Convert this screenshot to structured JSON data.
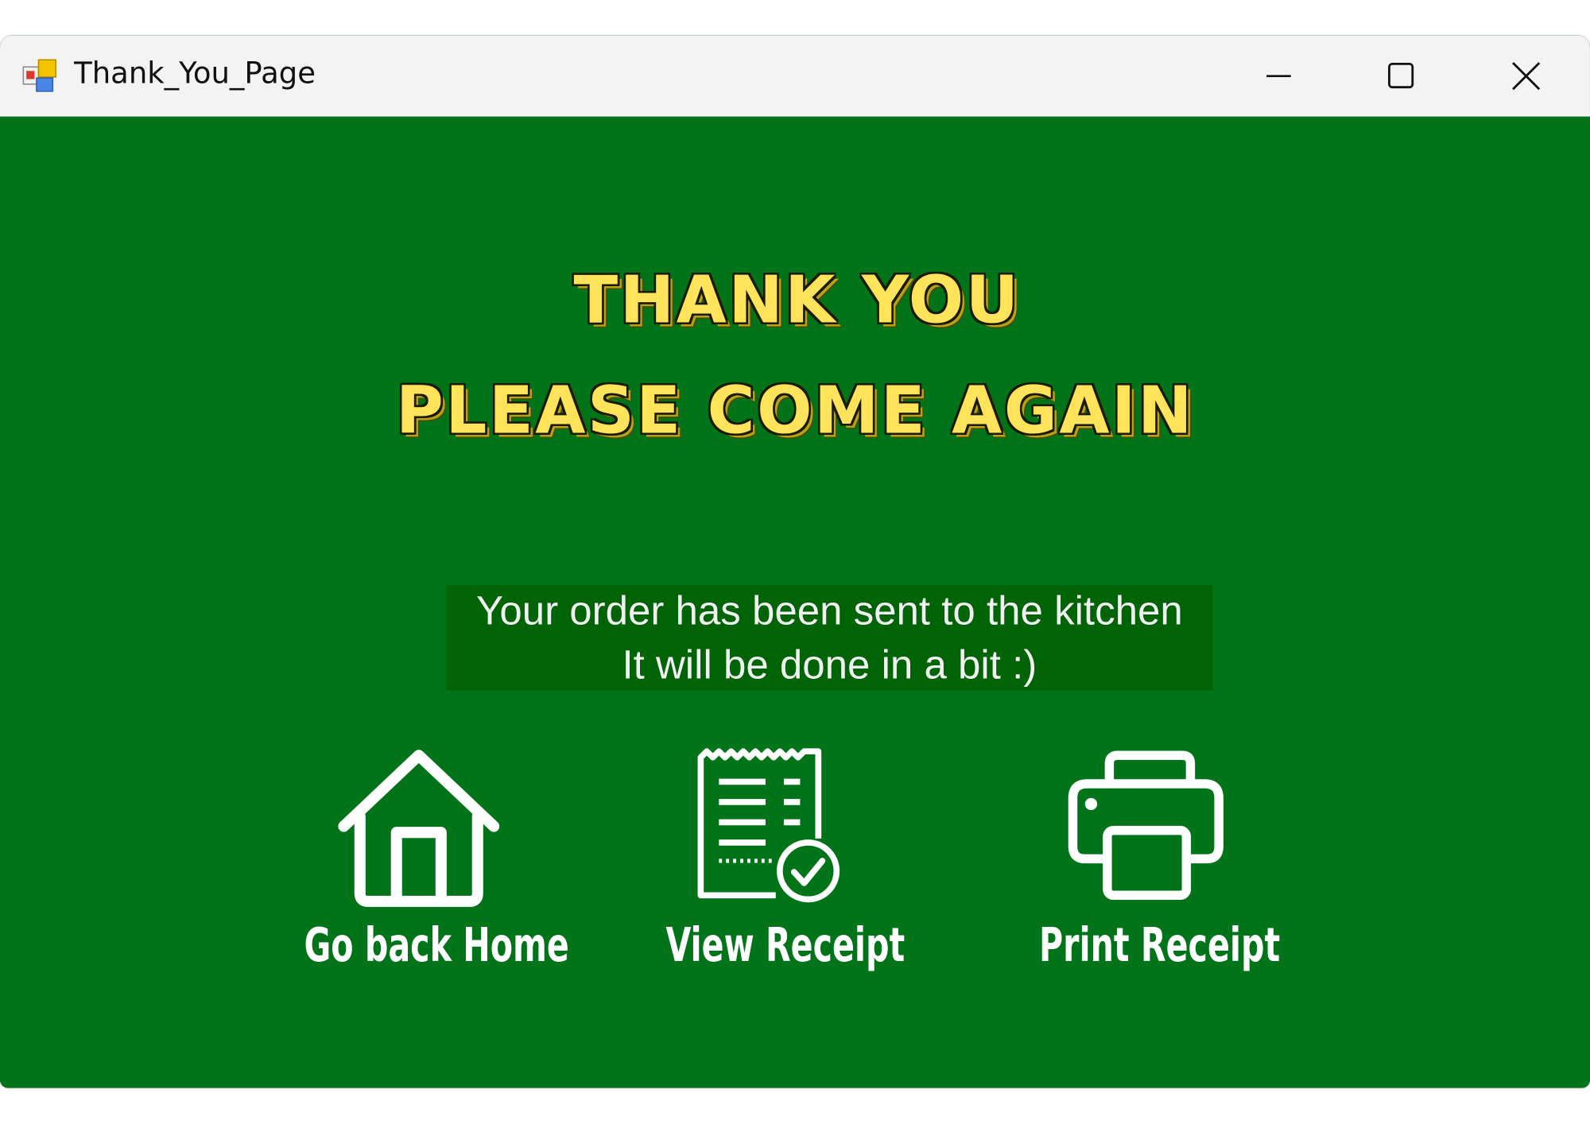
{
  "window": {
    "title": "Thank_You_Page",
    "controls": {
      "minimize_icon": "minimize-icon",
      "maximize_icon": "maximize-icon",
      "close_icon": "close-icon"
    }
  },
  "page": {
    "headline_line1": "THANK YOU",
    "headline_line2": "PLEASE COME AGAIN",
    "message_line1": "Your order has been sent to the kitchen",
    "message_line2": "It will be done in a bit :)"
  },
  "actions": [
    {
      "label": "Go back Home",
      "icon": "home-icon"
    },
    {
      "label": "View Receipt",
      "icon": "receipt-icon"
    },
    {
      "label": "Print Receipt",
      "icon": "printer-icon"
    }
  ],
  "colors": {
    "background": "#017419",
    "message_background": "#006406",
    "headline_fill": "#ffe35a",
    "titlebar": "#f3f3f3",
    "icon_and_label": "#ffffff"
  }
}
